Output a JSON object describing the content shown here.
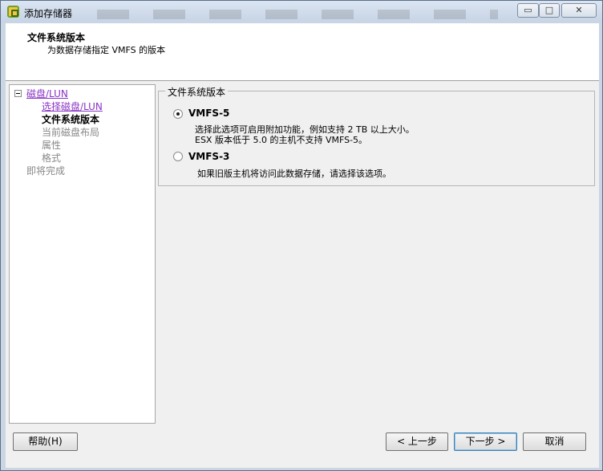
{
  "window": {
    "title": "添加存储器",
    "minimize_glyph": "▭",
    "maximize_glyph": "□",
    "close_glyph": "✕"
  },
  "header": {
    "title": "文件系统版本",
    "subtitle": "为数据存储指定 VMFS 的版本"
  },
  "nav": {
    "items": [
      {
        "label": "磁盘/LUN",
        "state": "link"
      },
      {
        "label": "选择磁盘/LUN",
        "state": "link"
      },
      {
        "label": "文件系统版本",
        "state": "current"
      },
      {
        "label": "当前磁盘布局",
        "state": "disabled"
      },
      {
        "label": "属性",
        "state": "disabled"
      },
      {
        "label": "格式",
        "state": "disabled"
      },
      {
        "label": "即将完成",
        "state": "disabled"
      }
    ]
  },
  "content": {
    "group_title": "文件系统版本",
    "options": [
      {
        "label": "VMFS-5",
        "selected": true,
        "desc1": "选择此选项可启用附加功能，例如支持 2 TB 以上大小。",
        "desc2": "ESX 版本低于 5.0 的主机不支持 VMFS-5。"
      },
      {
        "label": "VMFS-3",
        "selected": false,
        "desc1": "如果旧版主机将访问此数据存储，请选择该选项。"
      }
    ]
  },
  "buttons": {
    "help": "帮助(H)",
    "back": "< 上一步",
    "next": "下一步 >",
    "cancel": "取消"
  },
  "colors": {
    "link": "#8a35c4",
    "disabled_text": "#888888"
  }
}
